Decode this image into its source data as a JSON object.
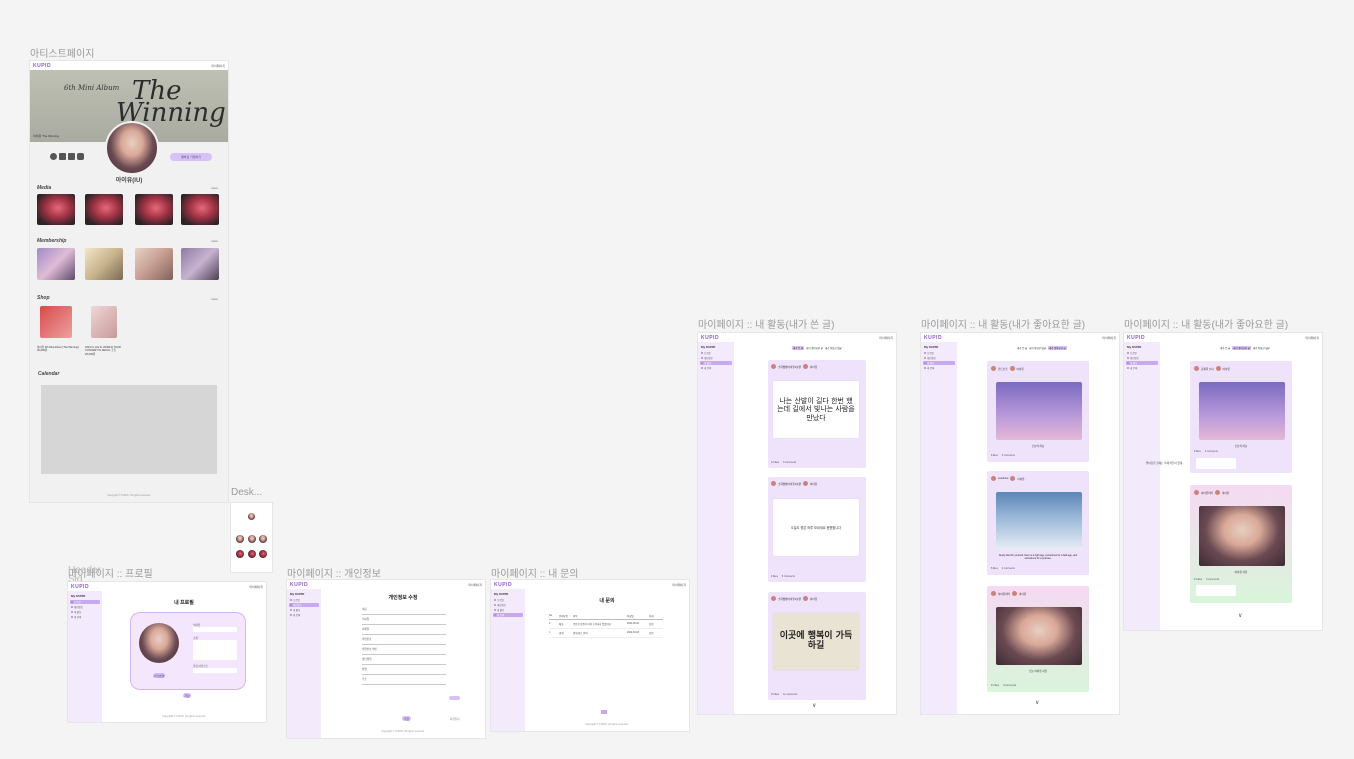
{
  "frames": {
    "artist": "아티스트페이지",
    "desktop": "Desk...",
    "profile": "마이페이지 :: 프로필",
    "profile_overlap_a": "Header",
    "profile_overlap_b": "Sid...",
    "info": "마이페이지 :: 개인정보",
    "inquiry": "마이페이지 :: 내 문의",
    "activity_written": "마이페이지 :: 내 활동(내가 쓴 글)",
    "activity_liked_1": "마이페이지 :: 내 활동(내가 좋아요한 글)",
    "activity_liked_2": "마이페이지 :: 내 활동(내가 좋아요한 글)"
  },
  "brand": {
    "logo": "KUPID",
    "util_link": "마이페이지",
    "accent": "#8a5ac8",
    "lavender": "#efe3fb"
  },
  "artist_page": {
    "hero_line1": "The",
    "hero_line2": "Winning",
    "hero_sub": "6th Mini Album",
    "hero_caption": "아이유 The Winning",
    "artist_name": "아이유(IU)",
    "join_button": "멤버십 가입하기",
    "social_icons": [
      "facebook-icon",
      "linkedin-icon",
      "youtube-icon",
      "instagram-icon"
    ],
    "sections": {
      "media": "Media",
      "membership": "Membership",
      "shop": "Shop",
      "calendar": "Calendar"
    },
    "more": "more",
    "shop_items": [
      {
        "title": "아이유 6th Mini Album [The Winning]",
        "price": "30,000원"
      },
      {
        "title": "2024 IU H.E.R. WORLD TOUR CONCERT IN SEOUL 굿즈",
        "price": "25,000원"
      }
    ]
  },
  "profile_page": {
    "sidebar_title": "My KUPID",
    "title": "내 프로필",
    "labels": [
      "닉네임",
      "소개",
      "관심 아티스트"
    ],
    "edit_photo": "사진변경",
    "save": "저장",
    "footer_text": "Copyright © KUPID. All rights reserved."
  },
  "info_page": {
    "sidebar_title": "My KUPID",
    "title": "개인정보 수정",
    "labels": [
      "이름",
      "닉네임",
      "이메일",
      "비밀번호",
      "비밀번호 확인",
      "생년월일",
      "성별",
      "주소"
    ],
    "save": "저장",
    "withdraw": "회원탈퇴",
    "footer_text": "Copyright © KUPID. All rights reserved."
  },
  "inquiry_page": {
    "sidebar_title": "My KUPID",
    "title": "내 문의",
    "columns": [
      "No",
      "문의유형",
      "제목",
      "작성일",
      "상태"
    ],
    "rows": [
      {
        "no": "2",
        "type": "배송",
        "title": "주문한 상품이 아직 도착하지 않았어요",
        "date": "2024.05.02",
        "status": "답변"
      },
      {
        "no": "1",
        "type": "결제",
        "title": "결제 취소 문의",
        "date": "2024.04.18",
        "status": "답변"
      }
    ],
    "footer_text": "Copyright © KUPID. All rights reserved."
  },
  "activity": {
    "sidebar_title": "My KUPID",
    "sidebar_items": [
      "프로필",
      "개인정보",
      "내 활동",
      "내 문의"
    ],
    "tabs": [
      "내가 쓴 글",
      "내가 좋아요한 글",
      "내가 작성한 댓글"
    ],
    "written_posts": [
      {
        "author": "소희짱짱아이유1호팬",
        "artist": "아이유",
        "text": "나는 산발이 길다 한번 했는데 길에서 빛나는 사람을 만났다",
        "likes": "12 likes",
        "comments": "8 comments"
      },
      {
        "author": "소희짱짱아이유1호팬",
        "artist": "아이유",
        "text": "오늘도 좋은 하루 보내세요 응원합니다",
        "likes": "9 likes",
        "comments": "5 comments"
      },
      {
        "author": "소희짱짱아이유1호팬",
        "artist": "아이유",
        "text": "이곳에 행복이 가득하길",
        "likes": "15 likes",
        "comments": "11 comments"
      }
    ],
    "liked_posts": [
      {
        "author": "민트초코",
        "artist": "아이유",
        "caption": "오늘의 하늘",
        "likes": "8 likes",
        "comments": "3 comments"
      },
      {
        "author": "sunshine",
        "artist": "아이유",
        "caption": "Study hard for yourself, there is a right age, sometimes for a bad age, and sometimes for a purpose.",
        "likes": "6 likes",
        "comments": "2 comments"
      },
      {
        "author": "아이유러버",
        "artist": "아이유",
        "caption": "오늘 아이유 사진",
        "likes": "21 likes",
        "comments": "9 comments"
      }
    ],
    "liked_posts_b": [
      {
        "author": "김재희 소녀",
        "artist": "아이유",
        "caption": "오늘의 하늘",
        "likes": "8 likes",
        "comments": "3 comments"
      },
      {
        "author": "아이유러버",
        "artist": "아이유",
        "caption": "아이유 사진",
        "likes": "21 likes",
        "comments": "9 comments"
      }
    ],
    "side_note": "좋아요한 글에는 삭제 버튼이 없게..."
  }
}
